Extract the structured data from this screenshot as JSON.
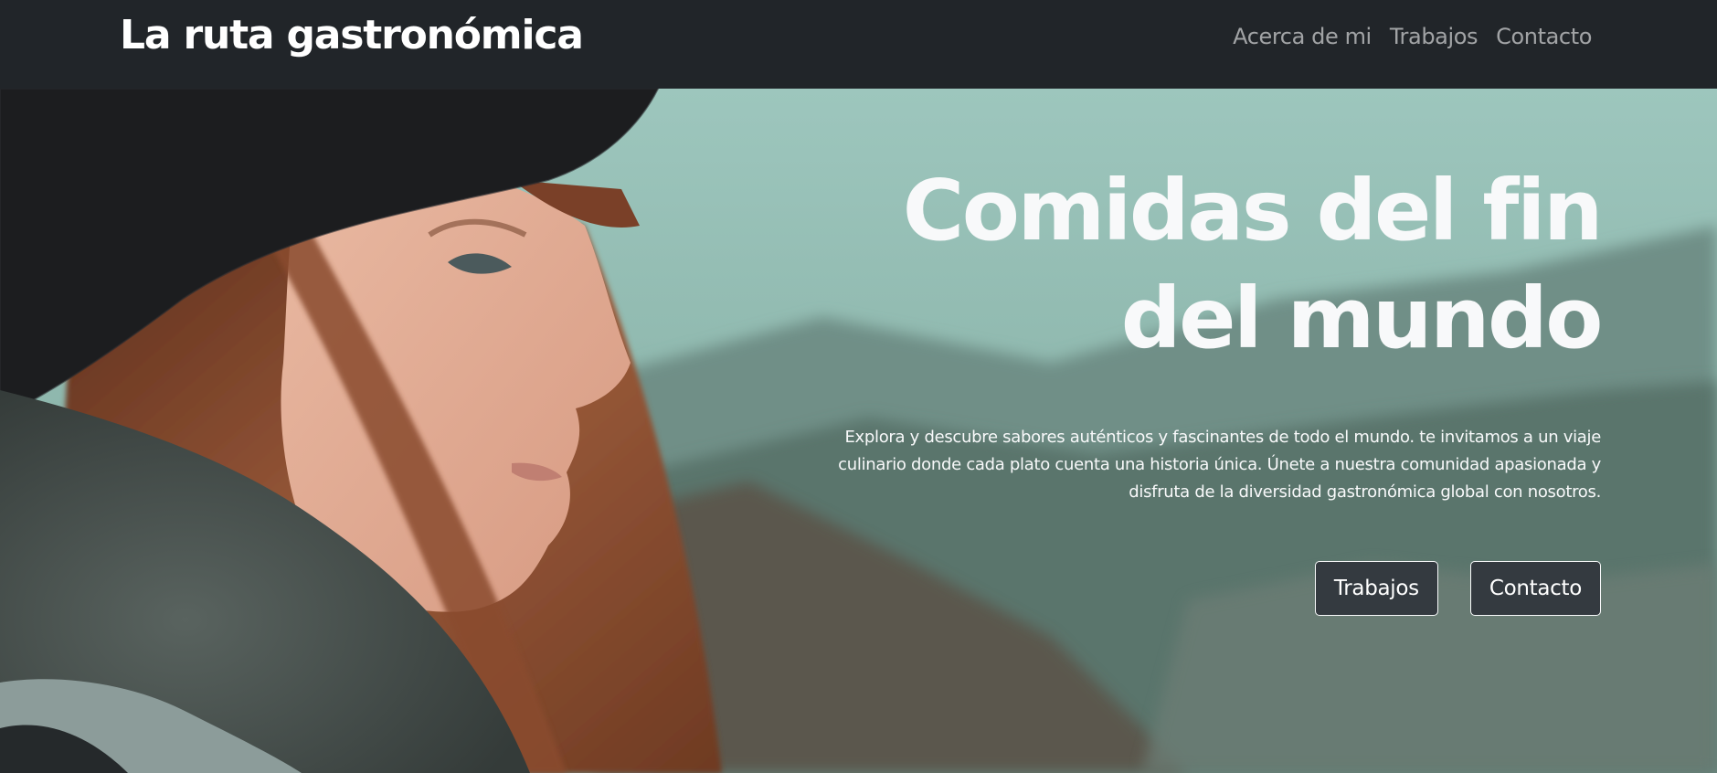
{
  "navbar": {
    "brand": "La ruta gastronómica",
    "links": [
      {
        "label": "Acerca de mi"
      },
      {
        "label": "Trabajos"
      },
      {
        "label": "Contacto"
      }
    ]
  },
  "hero": {
    "title": "Comidas del fin del mundo",
    "description": "Explora y descubre sabores auténticos y fascinantes de todo el mundo. te invitamos a un viaje culinario donde cada plato cuenta una historia única. Únete a nuestra comunidad apasionada y disfruta de la diversidad gastronómica global con nosotros.",
    "buttons": [
      {
        "label": "Trabajos"
      },
      {
        "label": "Contacto"
      }
    ]
  },
  "colors": {
    "navbar_bg": "#212529",
    "button_bg": "#343a40",
    "text_light": "#f8f9fa"
  }
}
